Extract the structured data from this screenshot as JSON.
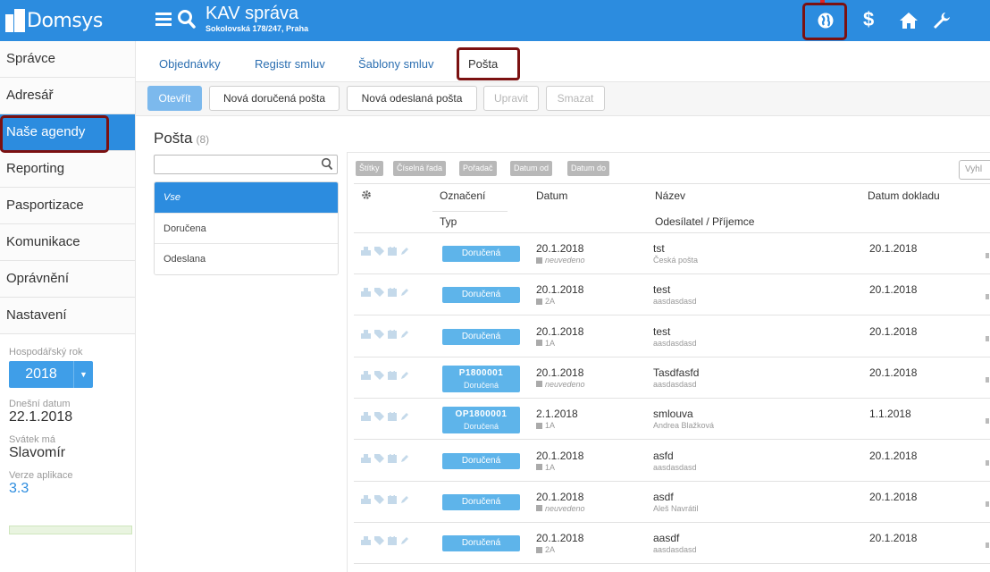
{
  "header": {
    "brand": "Domsys",
    "title": "KAV správa",
    "subtitle": "Sokolovská 178/247, Praha",
    "icons": [
      "menu-icon",
      "search-icon",
      "globe-icon",
      "dollar-icon",
      "home-icon",
      "wrench-icon"
    ],
    "dollar_symbol": "$",
    "accent": "#2c8cdf",
    "highlight_border": "#7b1111"
  },
  "sidebar": {
    "items": [
      {
        "label": "Správce"
      },
      {
        "label": "Adresář"
      },
      {
        "label": "Naše agendy"
      },
      {
        "label": "Reporting"
      },
      {
        "label": "Pasportizace"
      },
      {
        "label": "Komunikace"
      },
      {
        "label": "Oprávnění"
      },
      {
        "label": "Nastavení"
      }
    ],
    "active_item": "Naše agendy",
    "fiscal_year_label": "Hospodářský rok",
    "fiscal_year": "2018",
    "today_label": "Dnešní datum",
    "today": "22.1.2018",
    "nameday_label": "Svátek má",
    "nameday": "Slavomír",
    "version_label": "Verze aplikace",
    "version": "3.3"
  },
  "tabs": [
    {
      "label": "Objednávky"
    },
    {
      "label": "Registr smluv"
    },
    {
      "label": "Šablony smluv"
    },
    {
      "label": "Pošta"
    }
  ],
  "active_tab": "Pošta",
  "toolbar": {
    "open": "Otevřít",
    "new_received": "Nová doručená pošta",
    "new_sent": "Nová odeslaná pošta",
    "edit": "Upravit",
    "delete": "Smazat"
  },
  "main": {
    "title": "Pošta",
    "count": "(8)",
    "filters": [
      {
        "label": "Vse"
      },
      {
        "label": "Doručena"
      },
      {
        "label": "Odeslana"
      }
    ],
    "chips": [
      "Štítky",
      "Číselná řada",
      "Pořadač",
      "Datum od",
      "Datum do"
    ],
    "grid_search_placeholder": "Vyhl"
  },
  "table": {
    "headers": {
      "oznaceni": "Označení",
      "typ": "Typ",
      "datum": "Datum",
      "nazev": "Název",
      "odesilatel": "Odesílatel / Příjemce",
      "datum_dokladu": "Datum dokladu"
    },
    "rows": [
      {
        "code": "",
        "type": "Doručená",
        "date": "20.1.2018",
        "folder": "neuvedeno",
        "name": "tst",
        "party": "Česká pošta",
        "doc_date": "20.1.2018"
      },
      {
        "code": "",
        "type": "Doručená",
        "date": "20.1.2018",
        "folder": "2A",
        "name": "test",
        "party": "aasdasdasd",
        "doc_date": "20.1.2018"
      },
      {
        "code": "",
        "type": "Doručená",
        "date": "20.1.2018",
        "folder": "1A",
        "name": "test",
        "party": "aasdasdasd",
        "doc_date": "20.1.2018"
      },
      {
        "code": "P1800001",
        "type": "Doručená",
        "date": "20.1.2018",
        "folder": "neuvedeno",
        "name": "Tasdfasfd",
        "party": "aasdasdasd",
        "doc_date": "20.1.2018"
      },
      {
        "code": "OP1800001",
        "type": "Doručená",
        "date": "2.1.2018",
        "folder": "1A",
        "name": "smlouva",
        "party": "Andrea Blažková",
        "doc_date": "1.1.2018"
      },
      {
        "code": "",
        "type": "Doručená",
        "date": "20.1.2018",
        "folder": "1A",
        "name": "asfd",
        "party": "aasdasdasd",
        "doc_date": "20.1.2018"
      },
      {
        "code": "",
        "type": "Doručená",
        "date": "20.1.2018",
        "folder": "neuvedeno",
        "name": "asdf",
        "party": "Aleš Navrátil",
        "doc_date": "20.1.2018"
      },
      {
        "code": "",
        "type": "Doručená",
        "date": "20.1.2018",
        "folder": "2A",
        "name": "aasdf",
        "party": "aasdasdasd",
        "doc_date": "20.1.2018"
      }
    ]
  }
}
